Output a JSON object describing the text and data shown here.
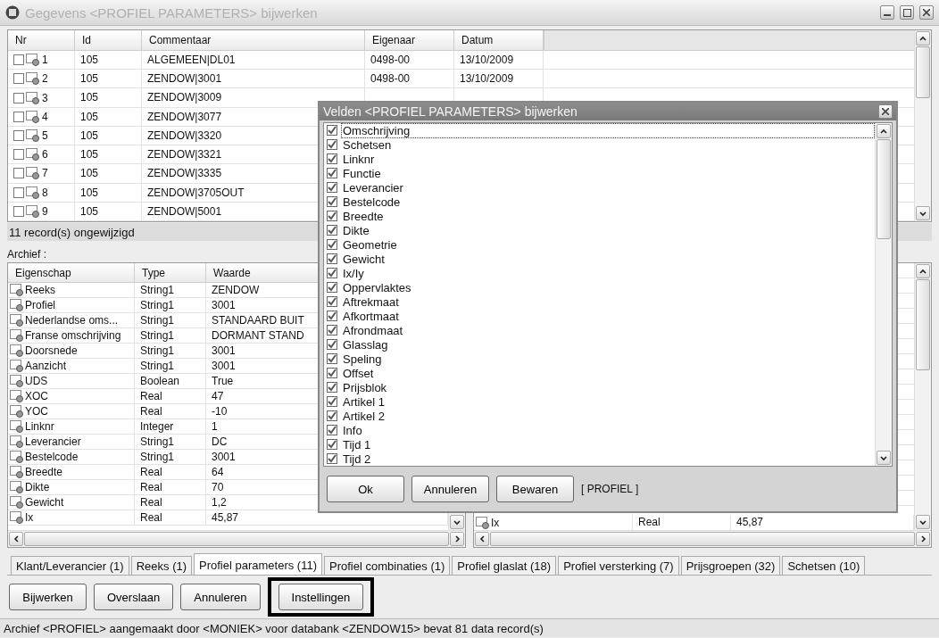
{
  "window": {
    "title": "Gegevens <PROFIEL PARAMETERS> bijwerken"
  },
  "records": {
    "columns": [
      "Nr",
      "Id",
      "Commentaar",
      "Eigenaar",
      "Datum"
    ],
    "rows": [
      {
        "checked": false,
        "nr": "1",
        "id": "105",
        "commentaar": "ALGEMEEN|DL01",
        "eigenaar": "0498-00",
        "datum": "13/10/2009"
      },
      {
        "checked": false,
        "nr": "2",
        "id": "105",
        "commentaar": "ZENDOW|3001",
        "eigenaar": "0498-00",
        "datum": "13/10/2009"
      },
      {
        "checked": false,
        "nr": "3",
        "id": "105",
        "commentaar": "ZENDOW|3009"
      },
      {
        "checked": false,
        "nr": "4",
        "id": "105",
        "commentaar": "ZENDOW|3077"
      },
      {
        "checked": false,
        "nr": "5",
        "id": "105",
        "commentaar": "ZENDOW|3320"
      },
      {
        "checked": false,
        "nr": "6",
        "id": "105",
        "commentaar": "ZENDOW|3321"
      },
      {
        "checked": false,
        "nr": "7",
        "id": "105",
        "commentaar": "ZENDOW|3335"
      },
      {
        "checked": false,
        "nr": "8",
        "id": "105",
        "commentaar": "ZENDOW|3705OUT"
      },
      {
        "checked": false,
        "nr": "9",
        "id": "105",
        "commentaar": "ZENDOW|5001"
      }
    ],
    "status": "11 record(s) ongewijzigd"
  },
  "archive": {
    "label": "Archief :",
    "left": {
      "columns": [
        "Eigenschap",
        "Type",
        "Waarde"
      ],
      "rows": [
        {
          "eigenschap": "Reeks",
          "type": "String1",
          "waarde": "ZENDOW"
        },
        {
          "eigenschap": "Profiel",
          "type": "String1",
          "waarde": "3001"
        },
        {
          "eigenschap": "Nederlandse oms...",
          "type": "String1",
          "waarde": "STANDAARD BUIT"
        },
        {
          "eigenschap": "Franse omschrijving",
          "type": "String1",
          "waarde": "DORMANT STAND"
        },
        {
          "eigenschap": "Doorsnede",
          "type": "String1",
          "waarde": "3001"
        },
        {
          "eigenschap": "Aanzicht",
          "type": "String1",
          "waarde": "3001"
        },
        {
          "eigenschap": "UDS",
          "type": "Boolean",
          "waarde": "True"
        },
        {
          "eigenschap": "XOC",
          "type": "Real",
          "waarde": "47"
        },
        {
          "eigenschap": "YOC",
          "type": "Real",
          "waarde": "-10"
        },
        {
          "eigenschap": "Linknr",
          "type": "Integer",
          "waarde": "1"
        },
        {
          "eigenschap": "Leverancier",
          "type": "String1",
          "waarde": "DC"
        },
        {
          "eigenschap": "Bestelcode",
          "type": "String1",
          "waarde": "3001"
        },
        {
          "eigenschap": "Breedte",
          "type": "Real",
          "waarde": "64"
        },
        {
          "eigenschap": "Dikte",
          "type": "Real",
          "waarde": "70"
        },
        {
          "eigenschap": "Gewicht",
          "type": "Real",
          "waarde": "1,2"
        },
        {
          "eigenschap": "Ix",
          "type": "Real",
          "waarde": "45,87"
        }
      ]
    },
    "right": {
      "rows": [
        {
          "eigenschap": "Ix",
          "type": "Real",
          "waarde": "45,87"
        }
      ]
    }
  },
  "tabs": [
    {
      "label": "Klant/Leverancier (1)",
      "selected": false
    },
    {
      "label": "Reeks (1)",
      "selected": false
    },
    {
      "label": "Profiel parameters (11)",
      "selected": true
    },
    {
      "label": "Profiel combinaties (1)",
      "selected": false
    },
    {
      "label": "Profiel glaslat (18)",
      "selected": false
    },
    {
      "label": "Profiel versterking (7)",
      "selected": false
    },
    {
      "label": "Prijsgroepen (32)",
      "selected": false
    },
    {
      "label": "Schetsen (10)",
      "selected": false
    }
  ],
  "buttons": [
    {
      "label": "Bijwerken",
      "focused": false
    },
    {
      "label": "Overslaan",
      "focused": false
    },
    {
      "label": "Annuleren",
      "focused": false
    },
    {
      "label": "Instellingen",
      "focused": true
    }
  ],
  "status_bar": "Archief <PROFIEL> aangemaakt door <MONIEK> voor databank <ZENDOW15> bevat 81 data record(s)",
  "dialog": {
    "title": "Velden <PROFIEL PARAMETERS> bijwerken",
    "fields": [
      {
        "label": "Omschrijving",
        "checked": true,
        "focused": true
      },
      {
        "label": "Schetsen",
        "checked": true,
        "focused": false
      },
      {
        "label": "Linknr",
        "checked": true,
        "focused": false
      },
      {
        "label": "Functie",
        "checked": true,
        "focused": false
      },
      {
        "label": "Leverancier",
        "checked": true,
        "focused": false
      },
      {
        "label": "Bestelcode",
        "checked": true,
        "focused": false
      },
      {
        "label": "Breedte",
        "checked": true,
        "focused": false
      },
      {
        "label": "Dikte",
        "checked": true,
        "focused": false
      },
      {
        "label": "Geometrie",
        "checked": true,
        "focused": false
      },
      {
        "label": "Gewicht",
        "checked": true,
        "focused": false
      },
      {
        "label": "Ix/Iy",
        "checked": true,
        "focused": false
      },
      {
        "label": "Oppervlaktes",
        "checked": true,
        "focused": false
      },
      {
        "label": "Aftrekmaat",
        "checked": true,
        "focused": false
      },
      {
        "label": "Afkortmaat",
        "checked": true,
        "focused": false
      },
      {
        "label": "Afrondmaat",
        "checked": true,
        "focused": false
      },
      {
        "label": "Glasslag",
        "checked": true,
        "focused": false
      },
      {
        "label": "Speling",
        "checked": true,
        "focused": false
      },
      {
        "label": "Offset",
        "checked": true,
        "focused": false
      },
      {
        "label": "Prijsblok",
        "checked": true,
        "focused": false
      },
      {
        "label": "Artikel 1",
        "checked": true,
        "focused": false
      },
      {
        "label": "Artikel 2",
        "checked": true,
        "focused": false
      },
      {
        "label": "Info",
        "checked": true,
        "focused": false
      },
      {
        "label": "Tijd 1",
        "checked": true,
        "focused": false
      },
      {
        "label": "Tijd 2",
        "checked": true,
        "focused": false
      }
    ],
    "buttons": [
      "Ok",
      "Annuleren",
      "Bewaren"
    ],
    "context": "[ PROFIEL ]"
  }
}
